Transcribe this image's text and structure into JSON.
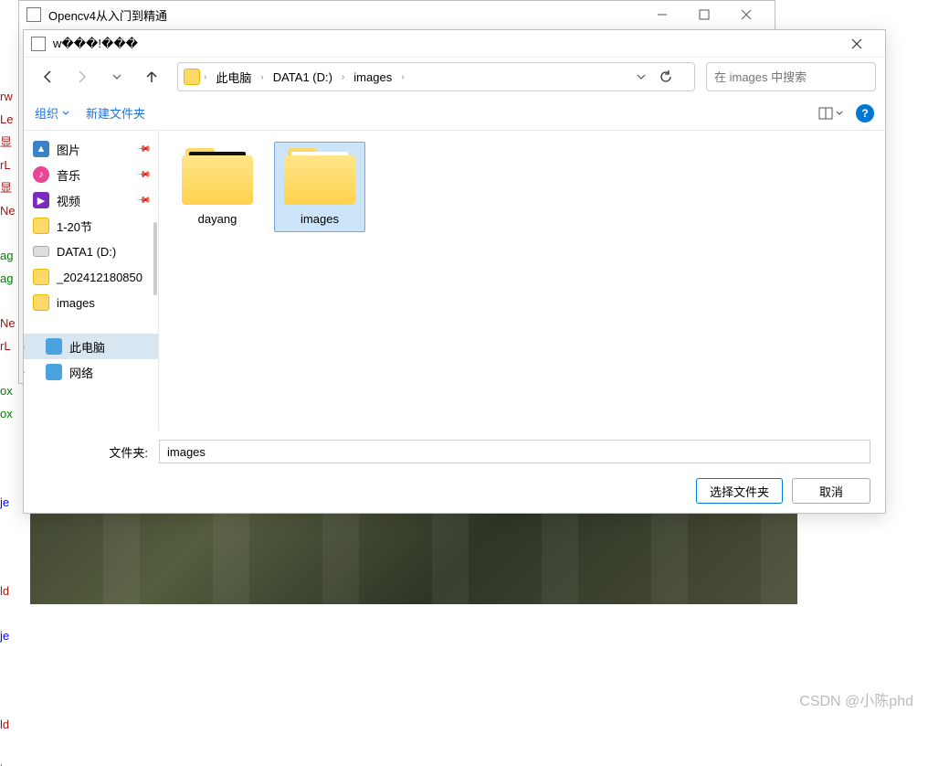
{
  "outer_window": {
    "title": "Opencv4从入门到精通"
  },
  "dialog": {
    "title": "w���!���",
    "breadcrumb": {
      "root": "此电脑",
      "drive": "DATA1 (D:)",
      "folder": "images"
    },
    "search_placeholder": "在 images 中搜索",
    "toolbar": {
      "organize": "组织",
      "new_folder": "新建文件夹"
    },
    "sidebar": {
      "pictures": "图片",
      "music": "音乐",
      "video": "视频",
      "folder1": "1-20节",
      "drive": "DATA1 (D:)",
      "folder2": "_202412180850",
      "folder3": "images",
      "this_pc": "此电脑",
      "network": "网络"
    },
    "items": {
      "dayang": "dayang",
      "images": "images"
    },
    "footer": {
      "label": "文件夹:",
      "value": "images",
      "select": "选择文件夹",
      "cancel": "取消"
    }
  },
  "watermark": "CSDN @小陈phd",
  "bg_code_lines": [
    "rw",
    "Le",
    "显",
    "rL",
    "显",
    "Ne",
    "ag",
    "ag",
    "Ne",
    "rL",
    "ox",
    "ox",
    "je",
    "ld",
    "je",
    "ld",
    "je"
  ]
}
